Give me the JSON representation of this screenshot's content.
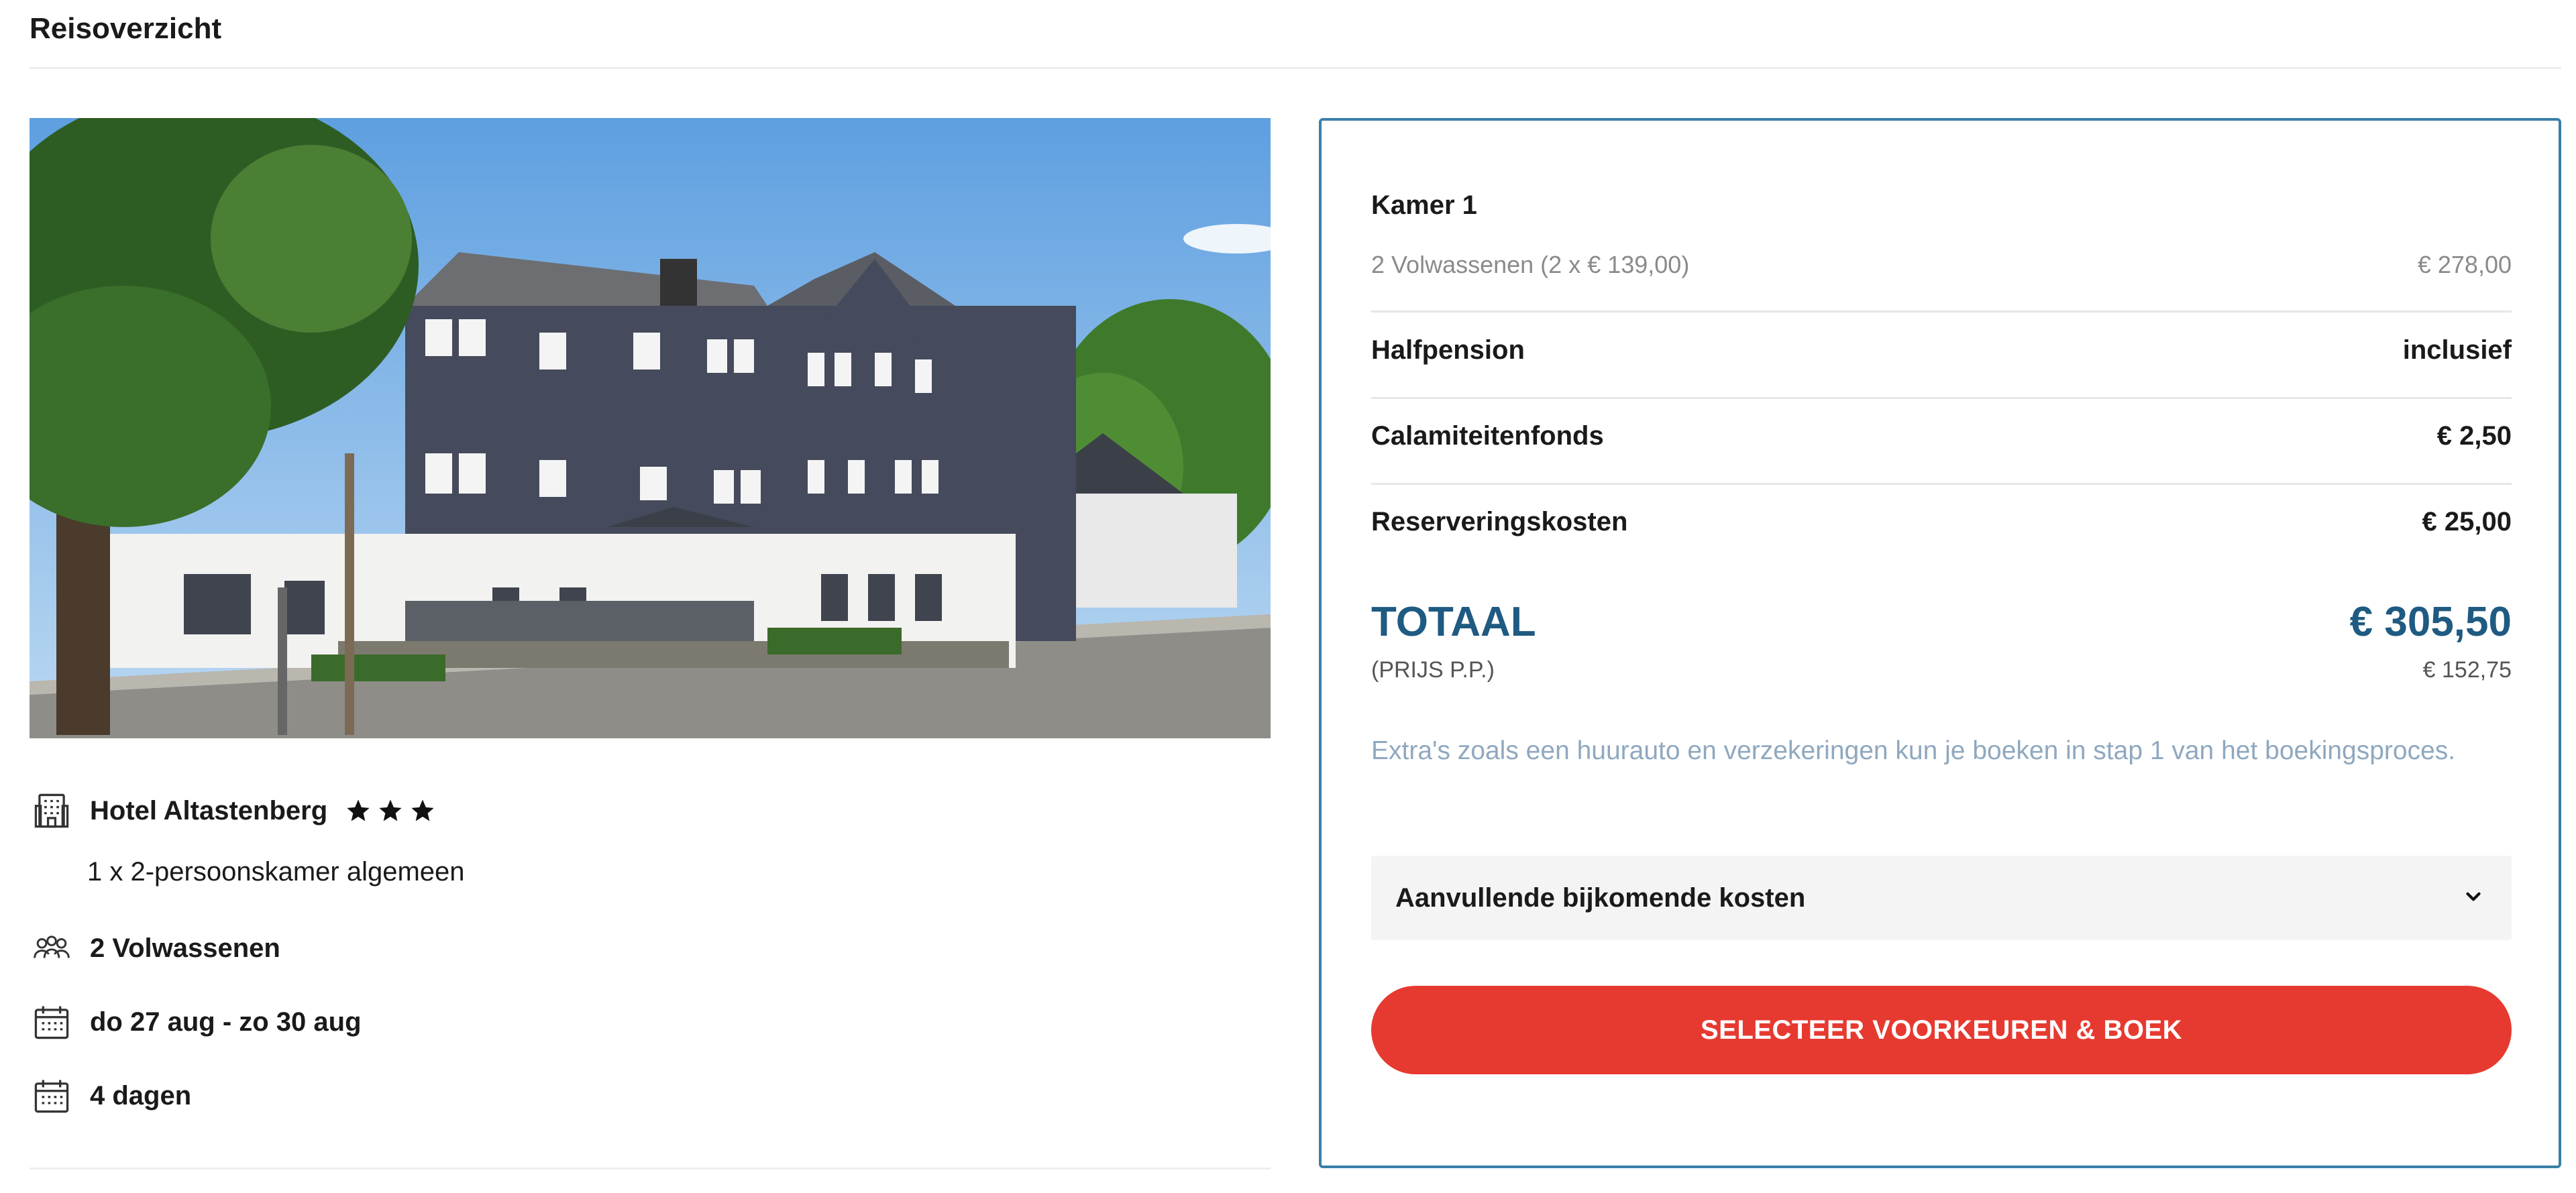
{
  "page": {
    "title": "Reisoverzicht"
  },
  "hotel": {
    "photo_alt": "Hotel Altastenberg",
    "name": "Hotel Altastenberg",
    "stars": 3,
    "room": "1 x 2-persoonskamer algemeen",
    "guests": "2 Volwassenen",
    "dates": "do 27 aug - zo 30 aug",
    "duration": "4 dagen",
    "icons": {
      "hotel": "hotel-building-icon",
      "guests": "people-icon",
      "dates": "calendar-icon",
      "duration": "calendar-icon",
      "star": "star-icon"
    }
  },
  "price": {
    "room": {
      "label": "Kamer 1",
      "detail": "2 Volwassenen (2 x € 139,00)",
      "detail_value": "€ 278,00"
    },
    "lines": [
      {
        "label": "Halfpension",
        "value": "inclusief"
      },
      {
        "label": "Calamiteitenfonds",
        "value": "€ 2,50"
      },
      {
        "label": "Reserveringskosten",
        "value": "€ 25,00"
      }
    ],
    "total": {
      "label": "TOTAAL",
      "value": "€ 305,50",
      "pp_label": "(PRIJS P.P.)",
      "pp_value": "€ 152,75"
    },
    "note": "Extra's zoals een huurauto en verzekeringen kun je boeken in stap 1 van het boekingsproces.",
    "extra_costs_label": "Aanvullende bijkomende kosten",
    "cta_label": "SELECTEER VOORKEUREN & BOEK"
  },
  "colors": {
    "accent_blue": "#1f5a82",
    "card_border": "#3a7fa8",
    "cta_red": "#e63a30",
    "note_text": "#8fa8bf"
  }
}
